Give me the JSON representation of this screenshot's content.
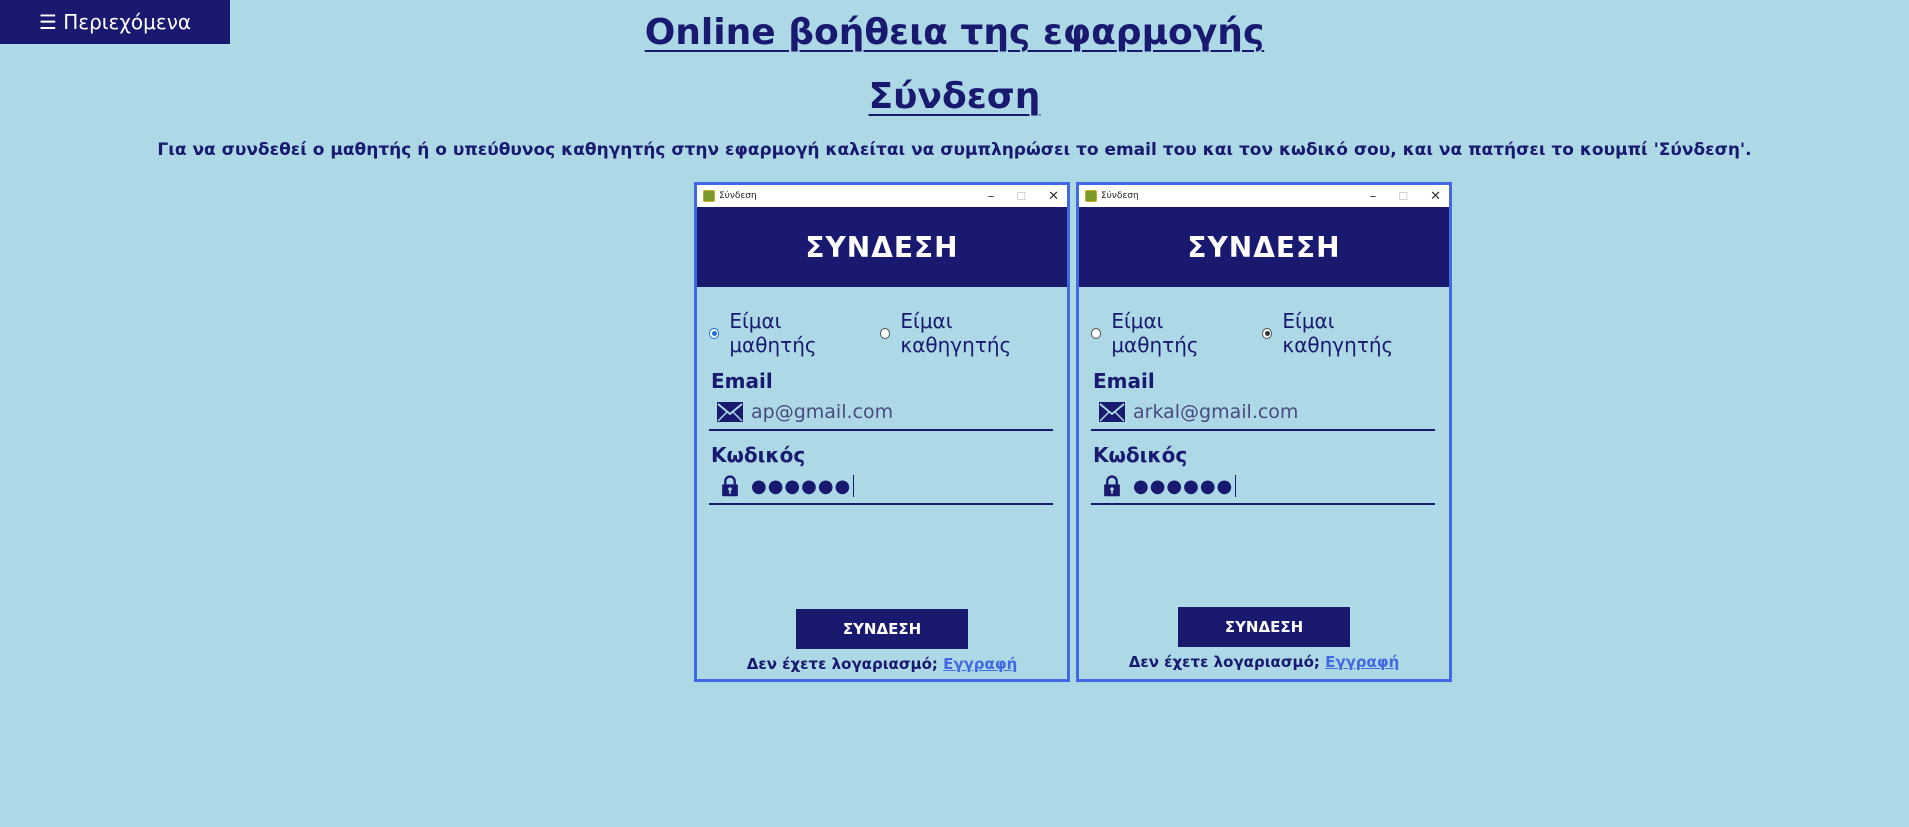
{
  "nav": {
    "toc_label": "☰ Περιεχόμενα"
  },
  "page": {
    "title": "Online βοήθεια της εφαρμογής",
    "section_title": "Σύνδεση",
    "description": "Για να συνδεθεί ο μαθητής ή ο υπεύθυνος καθηγητής στην εφαρμογή καλείται να συμπληρώσει το email του και τον κωδικό σου, και να πατήσει το κουμπί 'Σύνδεση'."
  },
  "screens": [
    {
      "window_title": "Σύνδεση",
      "header": "ΣΥΝΔΕΣΗ",
      "radio_student": "Είμαι μαθητής",
      "radio_teacher": "Είμαι καθηγητής",
      "selected_role": "student",
      "email_label": "Email",
      "email_value": "ap@gmail.com",
      "password_label": "Κωδικός",
      "password_value": "●●●●●●",
      "login_button": "ΣΥΝΔΕΣΗ",
      "signup_prompt": "Δεν έχετε λογαριασμό;",
      "signup_link": "Εγγραφή"
    },
    {
      "window_title": "Σύνδεση",
      "header": "ΣΥΝΔΕΣΗ",
      "radio_student": "Είμαι μαθητής",
      "radio_teacher": "Είμαι καθηγητής",
      "selected_role": "teacher",
      "email_label": "Email",
      "email_value": "arkal@gmail.com",
      "password_label": "Κωδικός",
      "password_value": "●●●●●●",
      "login_button": "ΣΥΝΔΕΣΗ",
      "signup_prompt": "Δεν έχετε λογαριασμό;",
      "signup_link": "Εγγραφή"
    }
  ],
  "colors": {
    "background": "#add8e6",
    "primary": "#191970",
    "accent_border": "#4169e1",
    "link": "#4169e1"
  },
  "icons": [
    "menu-icon",
    "app-icon",
    "minimize-icon",
    "maximize-icon",
    "close-icon",
    "envelope-icon",
    "lock-icon"
  ]
}
